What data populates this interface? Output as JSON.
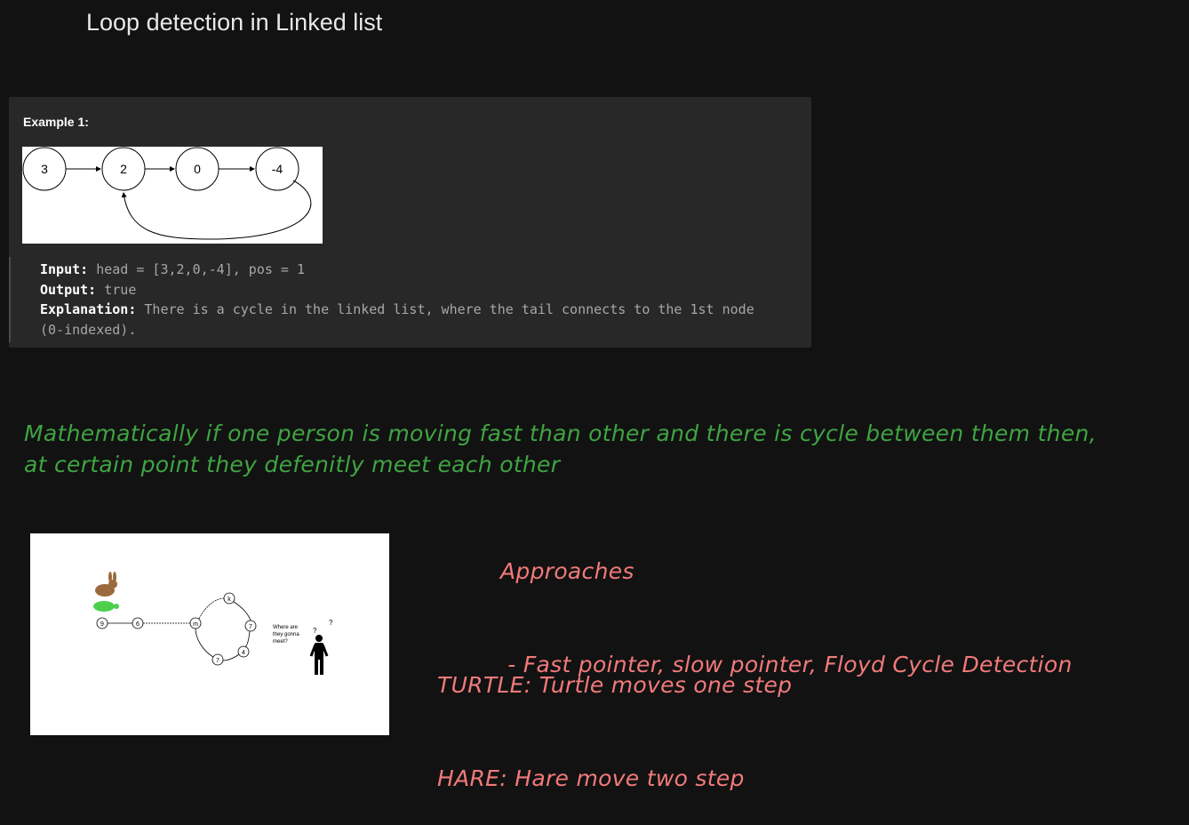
{
  "page": {
    "title": "Loop detection in Linked list"
  },
  "example": {
    "heading": "Example 1:",
    "nodes": [
      "3",
      "2",
      "0",
      "-4"
    ],
    "input_label": "Input:",
    "input_value": "head = [3,2,0,-4], pos = 1",
    "output_label": "Output:",
    "output_value": "true",
    "explanation_label": "Explanation:",
    "explanation_value": "There is a cycle in the linked list, where the tail connects to the 1st node",
    "explanation_cont": "(0-indexed)."
  },
  "notes": {
    "math_line1": "Mathematically if one person is moving fast than other and there is cycle between them then,",
    "math_line2": "at certain point they defenitly meet each other",
    "approaches_title": "Approaches",
    "approaches_item": " - Fast pointer, slow pointer, Floyd Cycle Detection",
    "turtle_line": "TURTLE: Turtle moves one step",
    "hare_line": "HARE: Hare move two step"
  },
  "illustration": {
    "nodes": [
      "9",
      "6",
      "m",
      "k",
      "7",
      "4",
      "7"
    ],
    "caption": [
      "Where are",
      "they gonna",
      "meet?"
    ],
    "question_marks": [
      "?",
      "?"
    ]
  },
  "colors": {
    "background": "#121212",
    "box": "#282828",
    "green_note": "#3fa442",
    "red_note": "#f27a7a"
  }
}
